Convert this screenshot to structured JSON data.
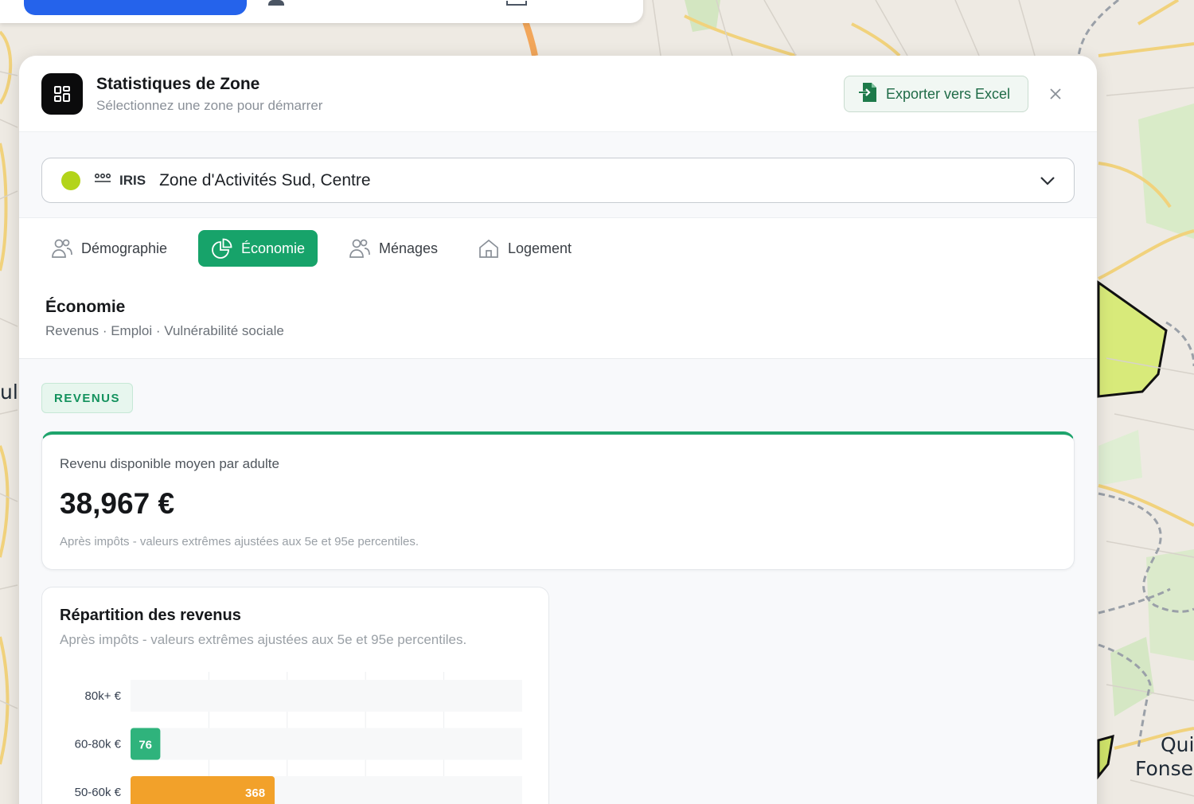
{
  "map": {
    "labels": [
      "ul",
      "Quin",
      "Fonseg"
    ]
  },
  "panel": {
    "title": "Statistiques de Zone",
    "subtitle": "Sélectionnez une zone pour démarrer",
    "export_label": "Exporter vers Excel",
    "icons": {
      "logo": "dashboard-icon",
      "export": "excel-icon",
      "close": "close-icon"
    }
  },
  "zone_selector": {
    "type": "IRIS",
    "name": "Zone d'Activités Sud, Centre",
    "dot_color": "#b3d41a"
  },
  "tabs": [
    {
      "label": "Démographie",
      "icon": "users-icon",
      "active": false
    },
    {
      "label": "Économie",
      "icon": "pie-chart-icon",
      "active": true
    },
    {
      "label": "Ménages",
      "icon": "users-icon",
      "active": false
    },
    {
      "label": "Logement",
      "icon": "home-icon",
      "active": false
    }
  ],
  "section": {
    "title": "Économie",
    "subtitle": "Revenus · Emploi · Vulnérabilité sociale"
  },
  "badge": "REVENUS",
  "stat_card": {
    "label": "Revenu disponible moyen par adulte",
    "value": "38,967 €",
    "note": "Après impôts - valeurs extrêmes ajustées aux 5e et 95e percentiles."
  },
  "chart_card": {
    "title": "Répartition des revenus",
    "subtitle": "Après impôts - valeurs extrêmes ajustées aux 5e et 95e percentiles."
  },
  "chart_data": {
    "type": "bar",
    "orientation": "horizontal",
    "title": "Répartition des revenus",
    "categories": [
      "80k+ €",
      "60-80k €",
      "50-60k €"
    ],
    "values": [
      0,
      76,
      368
    ],
    "data_labels": [
      "",
      "76",
      "368"
    ],
    "xlim": [
      0,
      1000
    ],
    "grid": true,
    "colors": [
      "#2fb37c",
      "#2fb37c",
      "#f2a12a"
    ]
  },
  "colors": {
    "accent": "#17a36a",
    "primary_blue": "#2563eb"
  }
}
